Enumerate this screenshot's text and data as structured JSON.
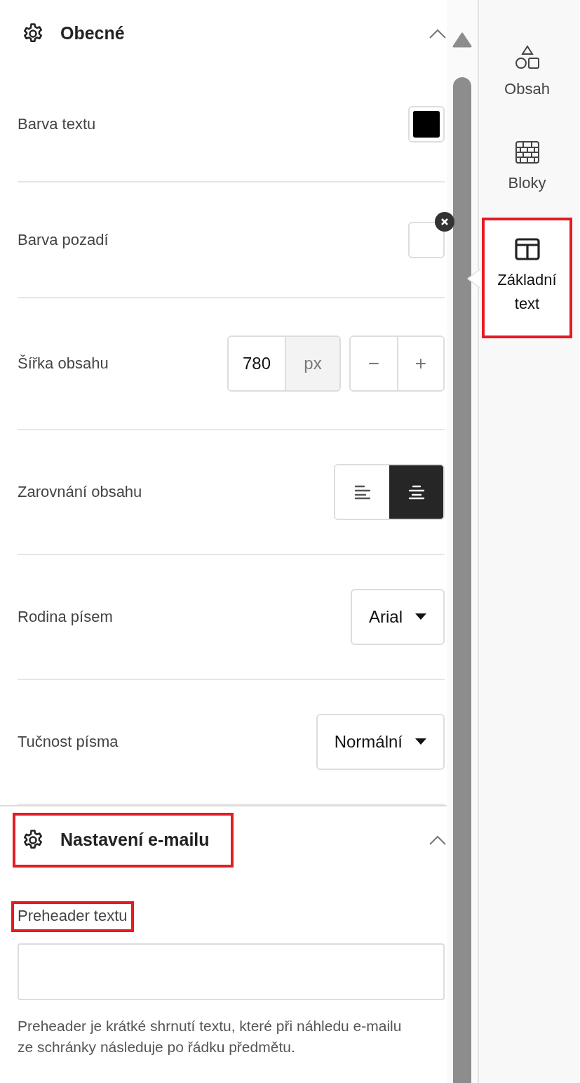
{
  "sections": [
    {
      "title": "Obecné",
      "expanded": true,
      "highlighted": false,
      "rows": [
        {
          "kind": "color",
          "label": "Barva textu",
          "color": "#000000",
          "clearable": false
        },
        {
          "kind": "color",
          "label": "Barva pozadí",
          "clearable": true
        },
        {
          "kind": "number",
          "label": "Šířka obsahu",
          "value": "780",
          "unit": "px",
          "decrement": "−",
          "increment": "+"
        },
        {
          "kind": "align",
          "label": "Zarovnání obsahu",
          "options": [
            {
              "kind": "left",
              "selected": false
            },
            {
              "kind": "center",
              "selected": true
            }
          ]
        },
        {
          "kind": "select",
          "label": "Rodina písem",
          "value": "Arial"
        },
        {
          "kind": "select",
          "label": "Tučnost písma",
          "value": "Normální"
        }
      ]
    },
    {
      "title": "Nastavení e-mailu",
      "expanded": true,
      "highlighted": true,
      "rows": [
        {
          "kind": "textarea",
          "label": "Preheader textu",
          "highlighted": true,
          "help": "Preheader je krátké shrnutí textu, které při náhledu e-mailu ze schránky následuje po řádku předmětu."
        }
      ]
    }
  ],
  "sidebar": {
    "tabs": [
      {
        "label": "Obsah",
        "kind": "shapes",
        "selected": false,
        "highlighted": false
      },
      {
        "label": "Bloky",
        "kind": "bricks",
        "selected": false,
        "highlighted": false
      },
      {
        "label": "Základní text",
        "kind": "layout",
        "selected": true,
        "highlighted": true
      }
    ]
  }
}
